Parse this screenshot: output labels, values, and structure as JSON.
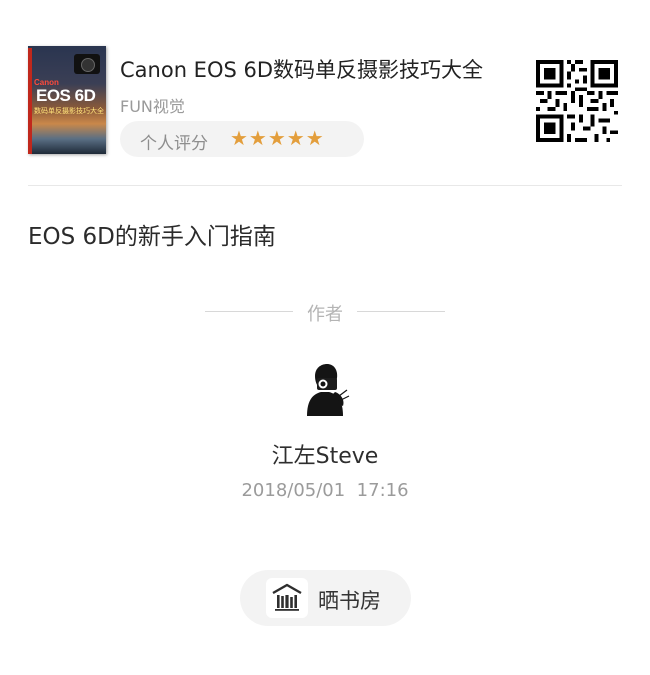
{
  "book": {
    "title": "Canon EOS 6D数码单反摄影技巧大全",
    "publisher": "FUN视觉",
    "rating_label": "个人评分",
    "rating_stars": 5,
    "stars_display": "★★★★★",
    "cover_brand": "Canon",
    "cover_model": "EOS 6D",
    "cover_subtitle": "数码单反摄影技巧大全"
  },
  "article": {
    "title": "EOS 6D的新手入门指南",
    "author_heading": "作者",
    "author_name": "江左Steve",
    "publish_date": "2018/05/01  17:16"
  },
  "brand": {
    "name": "晒书房",
    "icon": "bookshelf-icon"
  },
  "colors": {
    "star": "#e39e3c",
    "pill_bg": "#f3f3f3",
    "muted_text": "#9b9b9b"
  }
}
